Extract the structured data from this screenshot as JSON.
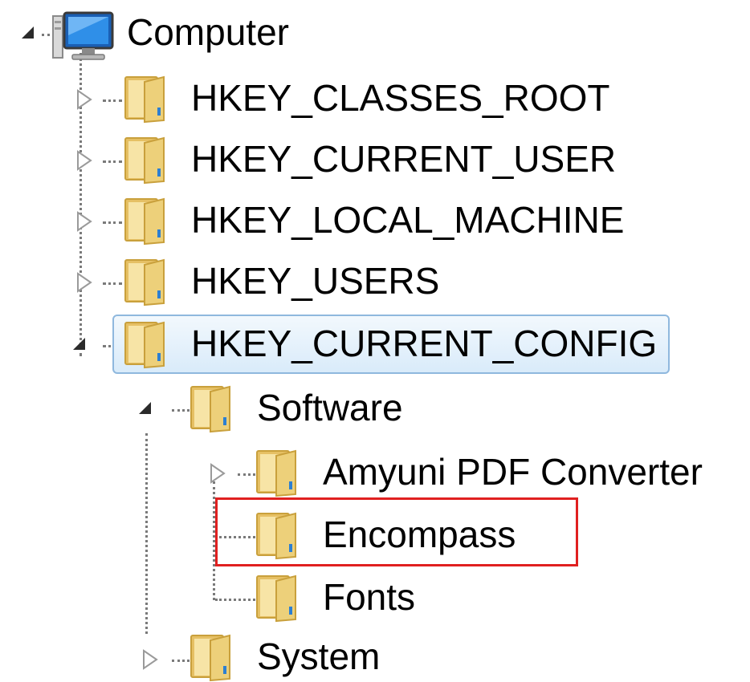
{
  "tree": {
    "root": {
      "label": "Computer",
      "expanded": true
    },
    "hives": [
      {
        "label": "HKEY_CLASSES_ROOT",
        "expanded": false
      },
      {
        "label": "HKEY_CURRENT_USER",
        "expanded": false
      },
      {
        "label": "HKEY_LOCAL_MACHINE",
        "expanded": false
      },
      {
        "label": "HKEY_USERS",
        "expanded": false
      },
      {
        "label": "HKEY_CURRENT_CONFIG",
        "expanded": true,
        "selected": true
      }
    ],
    "config_children": {
      "software": {
        "label": "Software",
        "expanded": true
      },
      "software_children": [
        {
          "label": "Amyuni PDF Converter",
          "expanded": false
        },
        {
          "label": "Encompass",
          "highlighted": true
        },
        {
          "label": "Fonts"
        }
      ],
      "system": {
        "label": "System",
        "expanded": false
      }
    }
  },
  "icons": {
    "collapsed": "triangle-right-icon",
    "expanded": "triangle-down-icon",
    "folder": "folder-icon",
    "computer": "computer-icon"
  },
  "colors": {
    "selection_border": "#8fb8de",
    "selection_fill": "#d9ebfa",
    "highlight_box": "#e02020",
    "folder": "#e8c867"
  }
}
